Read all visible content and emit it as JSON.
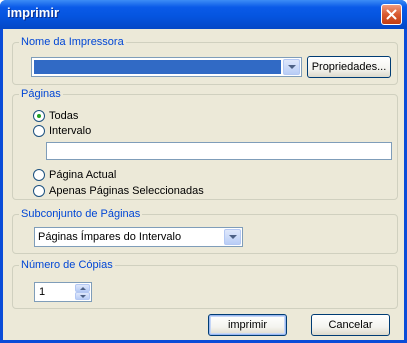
{
  "window": {
    "title": "imprimir"
  },
  "printer": {
    "legend": "Nome da Impressora",
    "selected": "",
    "properties_label": "Propriedades..."
  },
  "pages": {
    "legend": "Páginas",
    "options": [
      {
        "label": "Todas",
        "checked": true
      },
      {
        "label": "Intervalo",
        "checked": false
      },
      {
        "label": "Página Actual",
        "checked": false
      },
      {
        "label": "Apenas Páginas Seleccionadas",
        "checked": false
      }
    ],
    "range_value": ""
  },
  "subset": {
    "legend": "Subconjunto de Páginas",
    "selected": "Páginas Ímpares do Intervalo"
  },
  "copies": {
    "legend": "Número de Cópias",
    "value": "1"
  },
  "actions": {
    "print_label": "imprimir",
    "cancel_label": "Cancelar"
  },
  "colors": {
    "titlebar": "#0a5ae8",
    "dialog_bg": "#ece9d8",
    "groupbox_label": "#0046d5",
    "selection": "#316ac5",
    "close_button": "#d95a30"
  }
}
